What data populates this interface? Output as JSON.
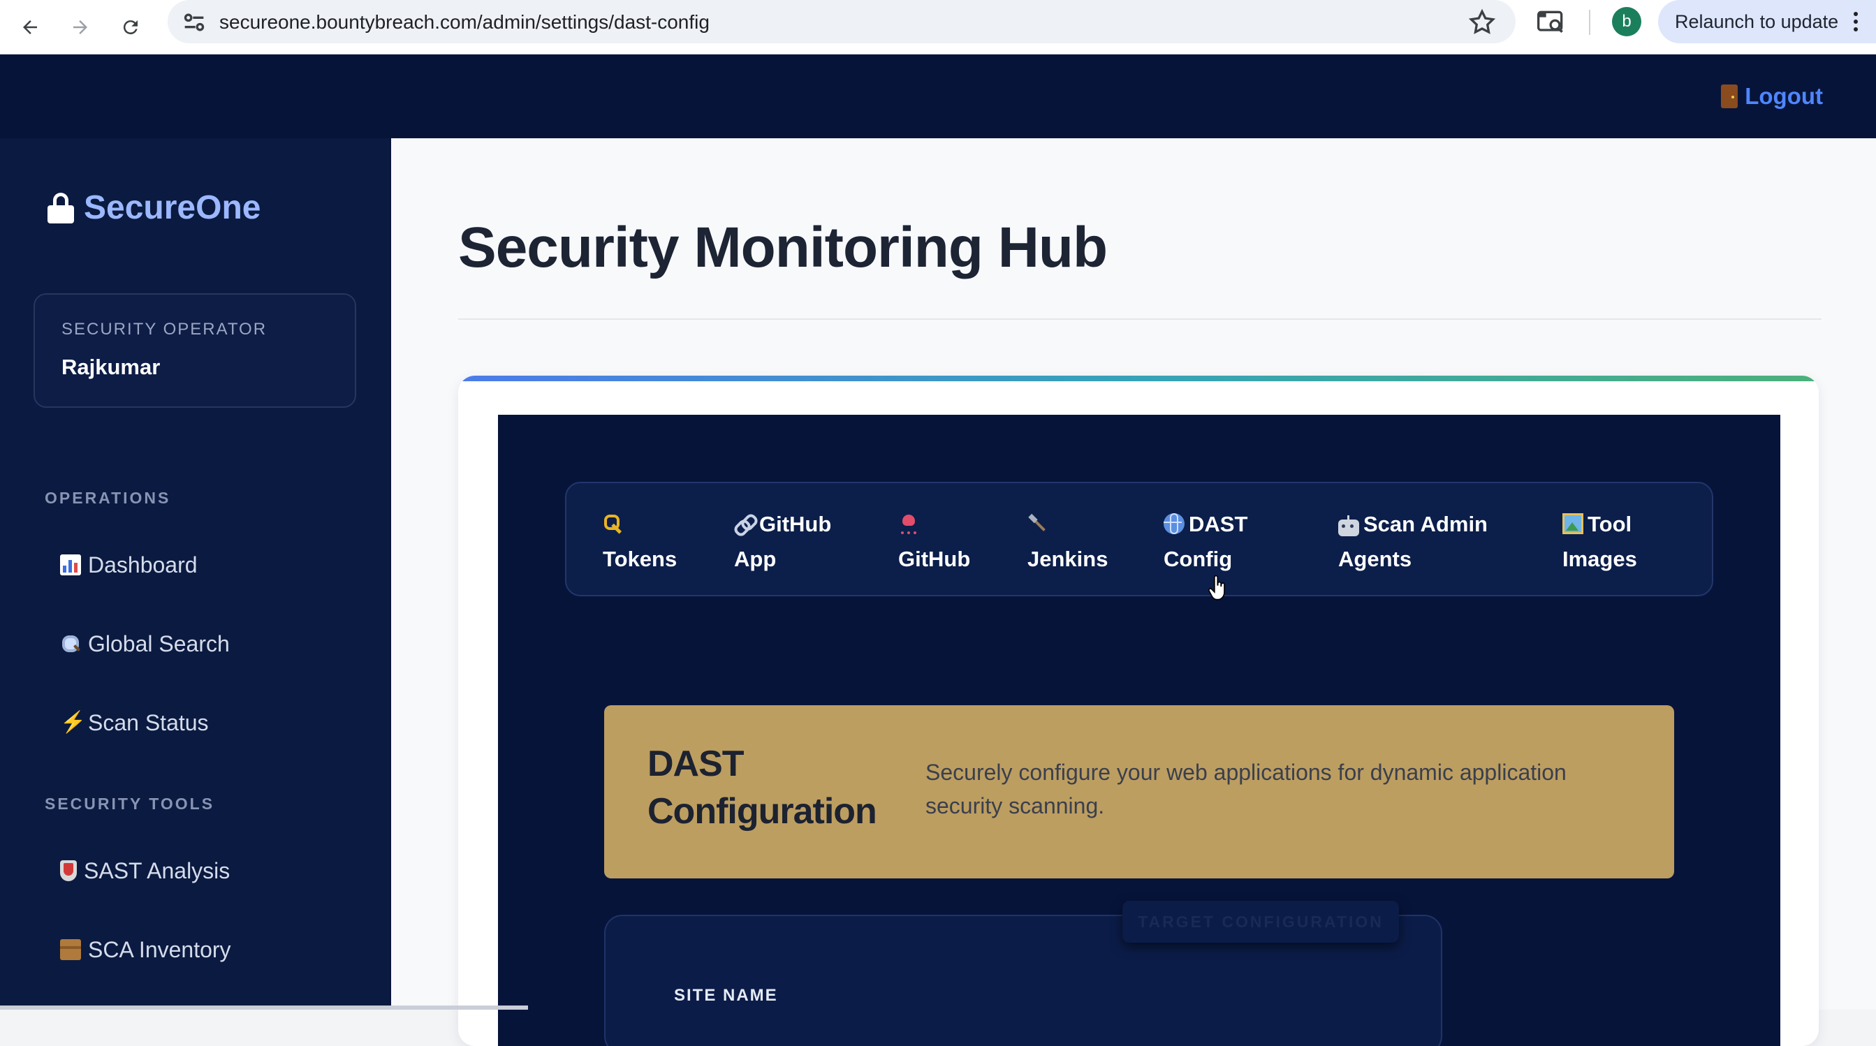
{
  "browser": {
    "url": "secureone.bountybreach.com/admin/settings/dast-config",
    "profile_initial": "b",
    "relaunch_label": "Relaunch to update"
  },
  "header": {
    "logout_label": "Logout"
  },
  "sidebar": {
    "brand": "SecureOne",
    "operator_role": "SECURITY OPERATOR",
    "operator_name": "Rajkumar",
    "sections": [
      {
        "heading": "OPERATIONS",
        "items": [
          {
            "label": "Dashboard",
            "icon": "bar-chart-icon"
          },
          {
            "label": "Global Search",
            "icon": "magnifier-icon"
          },
          {
            "label": "Scan Status",
            "icon": "lightning-icon"
          }
        ]
      },
      {
        "heading": "SECURITY TOOLS",
        "items": [
          {
            "label": "SAST Analysis",
            "icon": "shield-icon"
          },
          {
            "label": "SCA Inventory",
            "icon": "package-icon"
          }
        ]
      }
    ]
  },
  "main": {
    "page_title": "Security Monitoring Hub",
    "tabs": [
      {
        "icon": "key-icon",
        "line1": "Tokens",
        "line2": ""
      },
      {
        "icon": "link-icon",
        "line1": "GitHub",
        "line2": "App"
      },
      {
        "icon": "octopus-icon",
        "line1": "",
        "line2": "GitHub"
      },
      {
        "icon": "hammer-icon",
        "line1": "",
        "line2": "Jenkins"
      },
      {
        "icon": "globe-icon",
        "line1": "DAST",
        "line2": "Config"
      },
      {
        "icon": "robot-icon",
        "line1": "Scan Admin",
        "line2": "Agents"
      },
      {
        "icon": "framed-picture-icon",
        "line1": "Tool",
        "line2": "Images"
      }
    ],
    "active_tab": "DAST Config",
    "banner": {
      "title_line1": "DAST",
      "title_line2": "Configuration",
      "description": "Securely configure your web applications for dynamic application security scanning."
    },
    "form": {
      "chip_label": "TARGET CONFIGURATION",
      "site_name_label": "SITE NAME"
    }
  },
  "colors": {
    "header_bg": "#07143a",
    "sidebar_bg": "#0b1a40",
    "accent_blue": "#4f86ff",
    "banner_gold": "#bd9e61"
  }
}
